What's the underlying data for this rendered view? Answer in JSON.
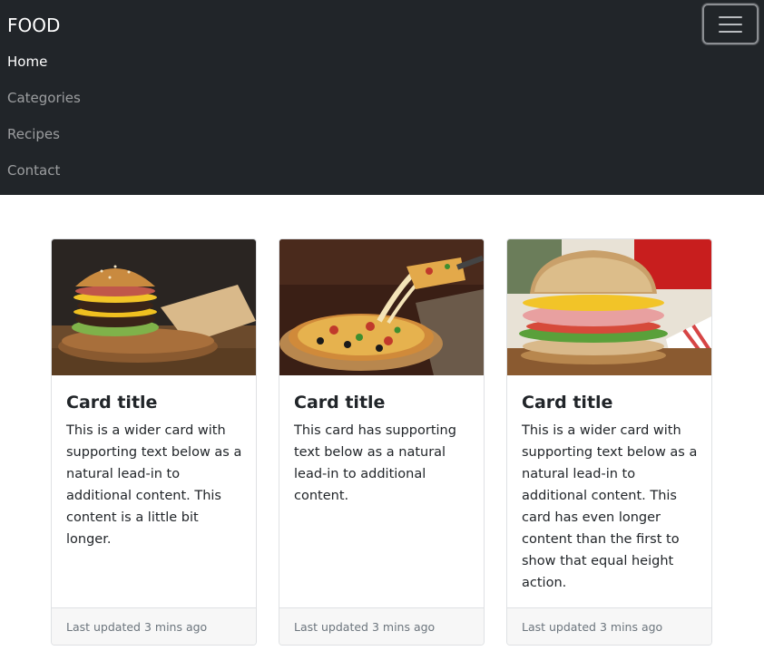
{
  "navbar": {
    "brand": "FOOD",
    "links": [
      {
        "label": "Home",
        "active": true
      },
      {
        "label": "Categories",
        "active": false
      },
      {
        "label": "Recipes",
        "active": false
      },
      {
        "label": "Contact",
        "active": false
      }
    ],
    "toggler_icon": "hamburger-icon"
  },
  "cards": [
    {
      "image": "burger-photo",
      "title": "Card title",
      "text": "This is a wider card with supporting text below as a natural lead-in to additional content. This content is a little bit longer.",
      "footer": "Last updated 3 mins ago"
    },
    {
      "image": "pizza-photo",
      "title": "Card title",
      "text": "This card has supporting text below as a natural lead-in to additional content.",
      "footer": "Last updated 3 mins ago"
    },
    {
      "image": "sandwich-photo",
      "title": "Card title",
      "text": "This is a wider card with supporting text below as a natural lead-in to additional content. This card has even longer content than the first to show that equal height action.",
      "footer": "Last updated 3 mins ago"
    }
  ],
  "colors": {
    "navbar_bg": "#212529",
    "footer_bg": "#f7f7f7",
    "muted_text": "#6c757d"
  }
}
